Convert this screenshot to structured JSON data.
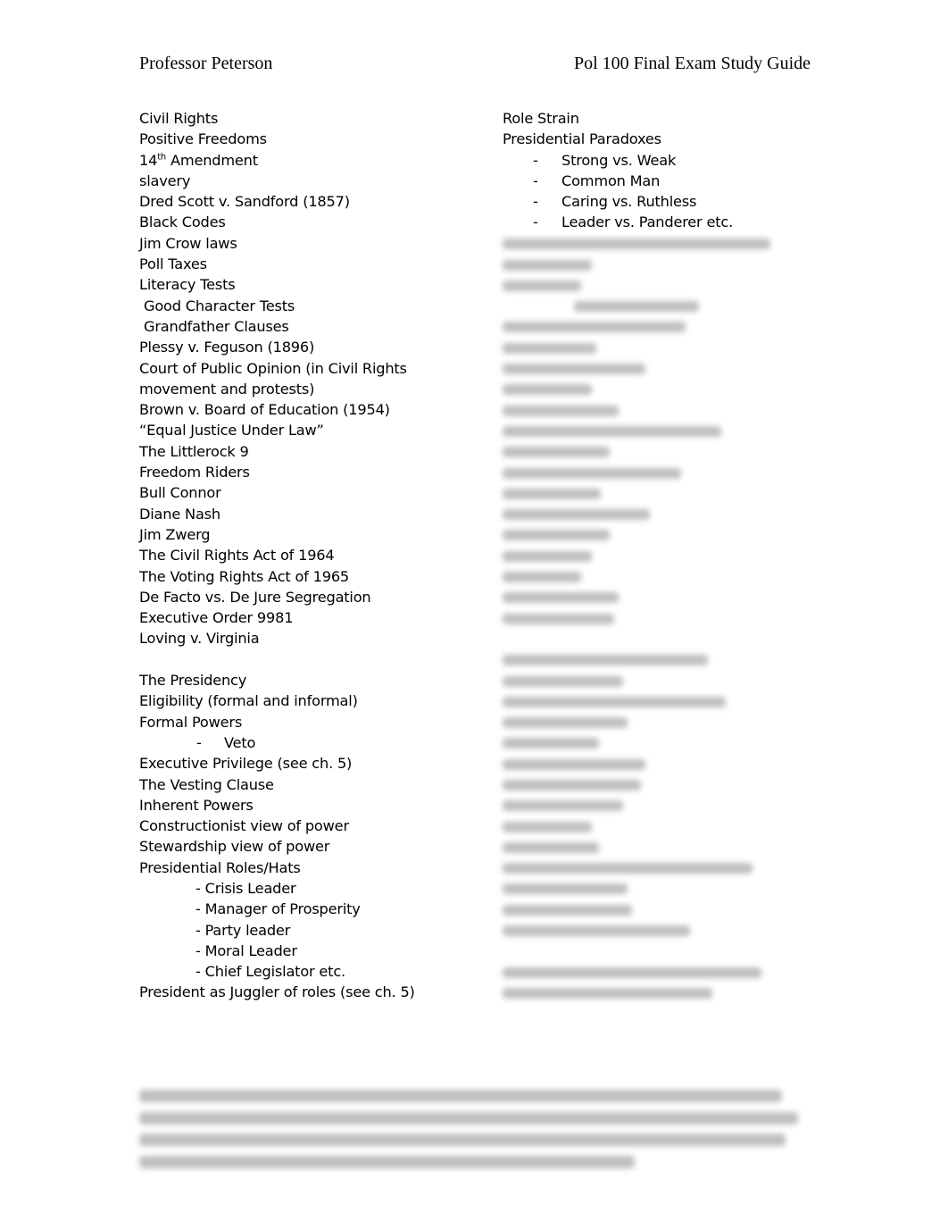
{
  "header": {
    "left": "Professor Peterson",
    "right": "Pol 100 Final Exam Study Guide"
  },
  "left_column": {
    "civil_rights": [
      "Civil Rights",
      "Positive Freedoms",
      "14",
      "slavery",
      "Dred Scott v. Sandford (1857)",
      "Black Codes",
      "Jim Crow laws",
      "Poll Taxes",
      "Literacy Tests",
      "Good Character Tests",
      "Grandfather Clauses",
      "Plessy v. Feguson (1896)",
      "Court of Public Opinion (in Civil Rights movement and protests)",
      "Brown v. Board of Education (1954)",
      "“Equal Justice Under Law”",
      "The Littlerock 9",
      "Freedom Riders",
      "Bull Connor",
      "Diane Nash",
      "Jim Zwerg",
      "The Civil Rights Act of 1964",
      "The Voting Rights Act of 1965",
      "De Facto vs. De Jure Segregation",
      "Executive Order 9981",
      "Loving v. Virginia"
    ],
    "amendment_sup": "th",
    "amendment_rest": " Amendment",
    "presidency": {
      "heading": "The Presidency",
      "items_a": [
        "Eligibility (formal and informal)",
        "Formal Powers"
      ],
      "veto_dash": "-",
      "veto": "Veto",
      "items_b": [
        "Executive Privilege (see ch. 5)",
        "The Vesting Clause",
        "Inherent Powers",
        "Constructionist view of power",
        "Stewardship view of power",
        "Presidential Roles/Hats"
      ],
      "roles": [
        "- Crisis Leader",
        "- Manager of Prosperity",
        "- Party leader",
        "- Moral Leader",
        "- Chief Legislator etc."
      ],
      "juggler": "President as Juggler of roles (see ch. 5)"
    }
  },
  "right_column": {
    "items": [
      "Role Strain",
      "Presidential Paradoxes"
    ],
    "dash": "-",
    "paradoxes": [
      "Strong vs. Weak",
      "Common Man",
      "Caring vs. Ruthless",
      "Leader vs. Panderer etc."
    ],
    "blurred_note": "Remaining content is blurred (preview locked)"
  },
  "footer": {
    "blurred_note": "Blurred note paragraph (unreadable)"
  }
}
